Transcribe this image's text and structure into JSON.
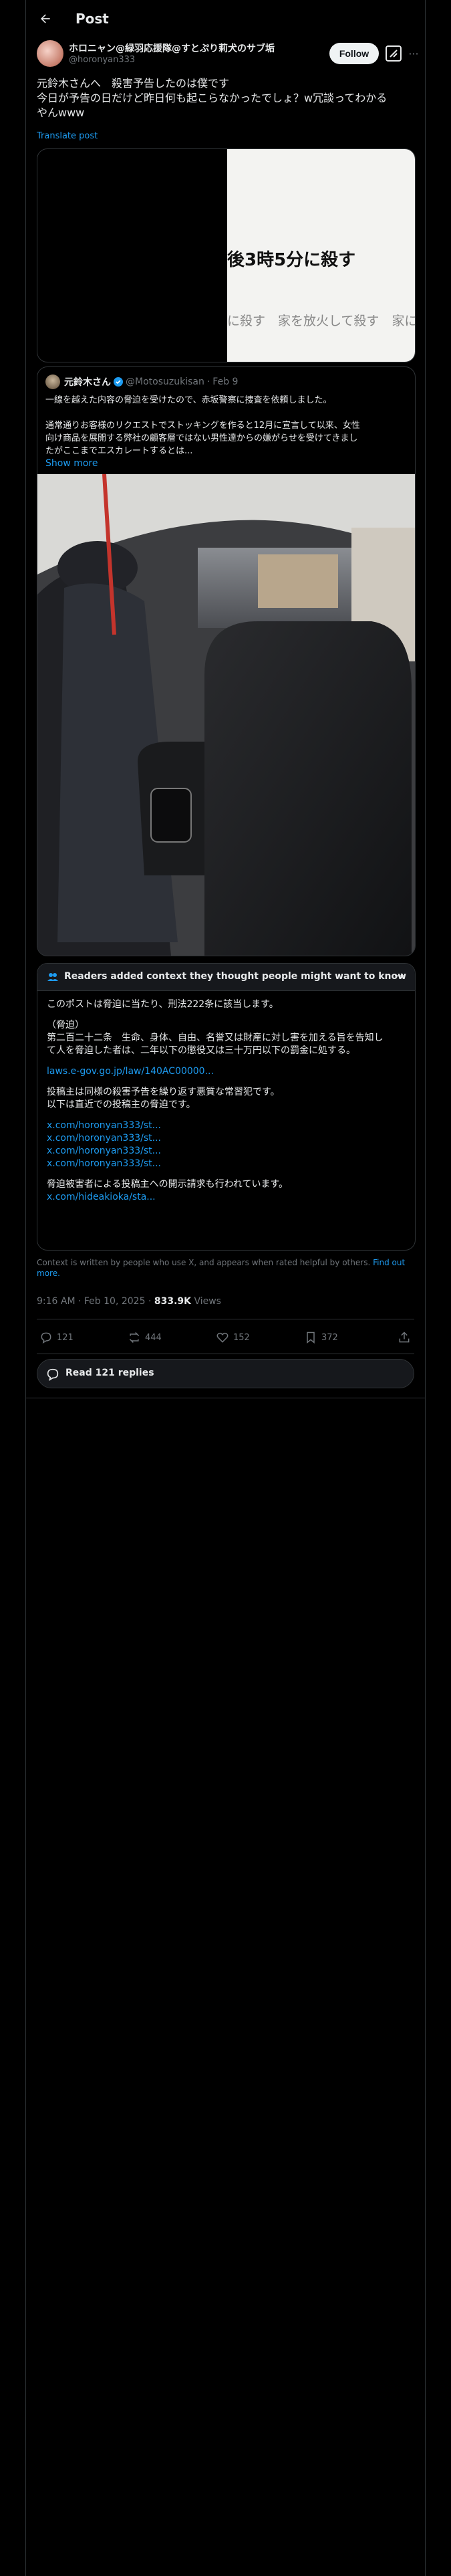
{
  "header": {
    "title": "Post"
  },
  "author": {
    "name": "ホロニャン@緑羽応援隊@すとぷり莉犬のサブ垢",
    "handle": "@horonyan333",
    "follow_label": "Follow"
  },
  "tweet": {
    "lines": [
      "元鈴木さんへ　殺害予告したのは僕です",
      "今日が予告の日だけど昨日何も起こらなかったでしょ？w冗談ってわかる",
      "やんwww"
    ],
    "translate_label": "Translate post",
    "image_text_large": "後3時5分に殺す",
    "image_text_small": "に殺す　家を放火して殺す　家に"
  },
  "quote": {
    "name": "元鈴木さん",
    "handle": "@Motosuzukisan",
    "date": "Feb 9",
    "separator": "·",
    "lines": [
      "一線を越えた内容の脅迫を受けたので、赤坂警察に捜査を依頼しました。",
      "",
      "通常通りお客様のリクエストでストッキングを作ると12月に宣言して以来、女性",
      "向け商品を展開する弊社の顧客層ではない男性達からの嫌がらせを受けてきまし",
      "たがここまでエスカレートするとは..."
    ],
    "show_more": "Show more"
  },
  "community_note": {
    "title": "Readers added context they thought people might want to know",
    "p1": "このポストは脅迫に当たり、刑法222条に該当します。",
    "p2_title": "（脅迫）",
    "p2_lines": [
      "第二百二十二条　生命、身体、自由、名誉又は財産に対し害を加える旨を告知し",
      "て人を脅迫した者は、二年以下の懲役又は三十万円以下の罰金に処する。"
    ],
    "law_link": "laws.e-gov.go.jp/law/140AC00000...",
    "p3_lines": [
      "投稿主は同様の殺害予告を繰り返す悪質な常習犯です。",
      "以下は直近での投稿主の脅迫です。"
    ],
    "links": [
      "x.com/horonyan333/st...",
      "x.com/horonyan333/st...",
      "x.com/horonyan333/st...",
      "x.com/horonyan333/st..."
    ],
    "p4": "脅迫被害者による投稿主への開示請求も行われています。",
    "p4_link": "x.com/hideakioka/sta..."
  },
  "note_footer": {
    "text": "Context is written by people who use X, and appears when rated helpful by others.",
    "link": "Find out more."
  },
  "meta": {
    "time": "9:16 AM · Feb 10, 2025",
    "dot": "·",
    "views_count": "833.9K",
    "views_label": "Views"
  },
  "actions": {
    "replies": "121",
    "reposts": "444",
    "likes": "152",
    "bookmarks": "372"
  },
  "read_replies_label": "Read 121 replies",
  "colors": {
    "accent": "#1d9bf0",
    "background": "#000000",
    "border": "#2f3336",
    "muted": "#71767b"
  }
}
